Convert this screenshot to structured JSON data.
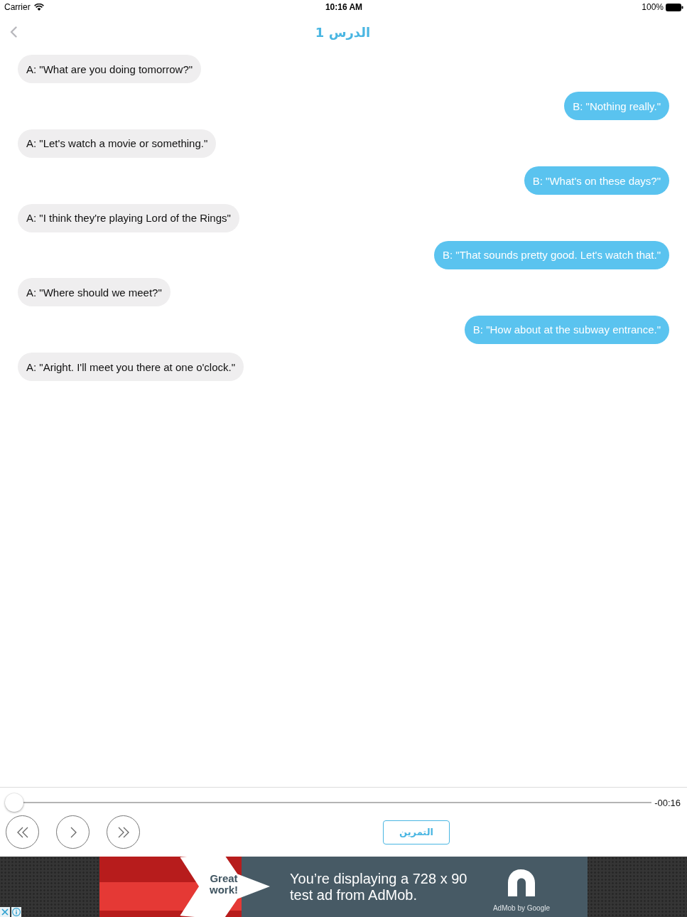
{
  "status_bar": {
    "carrier": "Carrier",
    "time": "10:16 AM",
    "battery": "100%"
  },
  "nav_bar": {
    "title": "الدرس 1"
  },
  "messages": [
    {
      "kind": "incoming",
      "text": "A: \"What are you doing tomorrow?\""
    },
    {
      "kind": "outgoing",
      "text": "B: \"Nothing really.\""
    },
    {
      "kind": "incoming",
      "text": "A: \"Let's watch a movie or something.\""
    },
    {
      "kind": "outgoing",
      "text": "B: \"What's on these days?\""
    },
    {
      "kind": "incoming",
      "text": "A: \"I think they're playing Lord of the Rings\""
    },
    {
      "kind": "outgoing",
      "text": "B: \"That sounds pretty good. Let's watch that.\""
    },
    {
      "kind": "incoming",
      "text": "A: \"Where should we meet?\""
    },
    {
      "kind": "outgoing",
      "text": "B: \"How about at the subway entrance.\""
    },
    {
      "kind": "incoming",
      "text": "A: \"Aright. I'll meet you there at one o'clock.\""
    }
  ],
  "player": {
    "level": 0,
    "remaining_time": "-00:16",
    "exercise_button": "التمرين"
  },
  "ad": {
    "badge": "Great work!",
    "message": "You’re displaying a 728 x 90 test ad from AdMob.",
    "brand": "AdMob by Google"
  }
}
